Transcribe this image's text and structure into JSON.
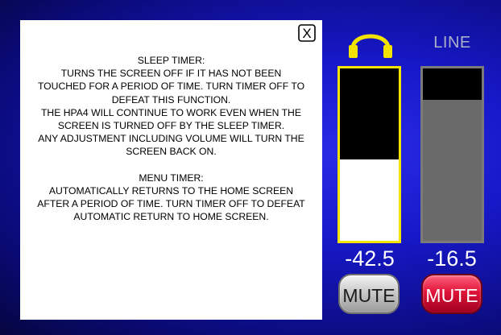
{
  "help": {
    "close_symbol": "X",
    "lines": [
      "SLEEP TIMER:",
      "TURNS THE SCREEN OFF IF IT HAS NOT BEEN",
      "TOUCHED FOR A PERIOD OF TIME. TURN TIMER OFF TO",
      "DEFEAT THIS FUNCTION.",
      "THE HPA4 WILL CONTINUE TO WORK EVEN WHEN THE",
      "SCREEN IS TURNED OFF BY THE SLEEP TIMER.",
      "ANY ADJUSTMENT INCLUDING VOLUME WILL TURN THE",
      "SCREEN BACK ON.",
      "",
      "MENU TIMER:",
      "AUTOMATICALLY RETURNS TO THE HOME SCREEN",
      "AFTER A PERIOD OF TIME. TURN TIMER OFF TO DEFEAT",
      "AUTOMATIC RETURN TO HOME SCREEN."
    ]
  },
  "headphone": {
    "icon": "headphones-icon",
    "level_text": "-42.5",
    "level_fraction": 0.47,
    "mute_label": "MUTE",
    "colors": {
      "accent": "#f2e400",
      "meter_bg": "#ffffff"
    }
  },
  "line": {
    "label": "LINE",
    "level_text": "-16.5",
    "level_fraction": 0.82,
    "mute_label": "MUTE",
    "colors": {
      "mute_active": "#e0143a",
      "meter_bg": "#6a6a6a"
    }
  }
}
